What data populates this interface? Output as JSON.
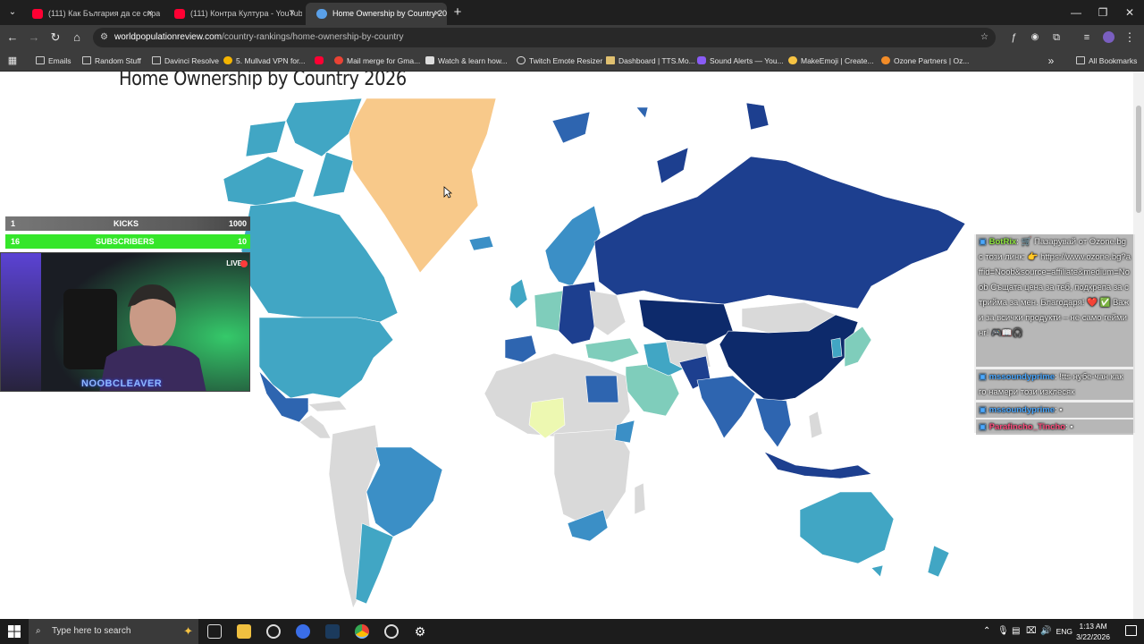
{
  "browser": {
    "tabs": [
      {
        "label": "(111) Как България да се справ",
        "active": false,
        "icon": "youtube-icon"
      },
      {
        "label": "(111) Контра Култура - YouTub",
        "active": false,
        "icon": "youtube-icon"
      },
      {
        "label": "Home Ownership by Country 20",
        "active": true,
        "icon": "globe-icon"
      }
    ],
    "new_tab": "+",
    "close_glyph": "×",
    "url_host": "worldpopulationreview.com",
    "url_path": "/country-rankings/home-ownership-by-country",
    "bookmarks": [
      {
        "label": "Emails",
        "icon": "folder-icon"
      },
      {
        "label": "Random Stuff",
        "icon": "folder-icon"
      },
      {
        "label": "Davinci Resolve",
        "icon": "folder-icon"
      },
      {
        "label": "5. Mullvad VPN for...",
        "icon": "mullvad-icon"
      },
      {
        "label": "",
        "icon": "youtube-icon"
      },
      {
        "label": "Mail merge for Gma...",
        "icon": "mail-merge-icon"
      },
      {
        "label": "Watch & learn how...",
        "icon": "camera-icon"
      },
      {
        "label": "Twitch Emote Resizer",
        "icon": "gear-icon"
      },
      {
        "label": "Dashboard | TTS.Mo...",
        "icon": "bookmark-icon"
      },
      {
        "label": "Sound Alerts — You...",
        "icon": "sound-alerts-icon"
      },
      {
        "label": "MakeEmoji | Create...",
        "icon": "emoji-icon"
      },
      {
        "label": "Ozone Partners | Oz...",
        "icon": "ozone-icon"
      }
    ],
    "all_bookmarks": "All Bookmarks",
    "more_glyph": "»"
  },
  "page": {
    "title": "Home Ownership by Country 2026",
    "map_colors": {
      "darkest": "#0d2a6b",
      "dark": "#1d3f8f",
      "mid_dark": "#2e65b0",
      "mid": "#3b8fc6",
      "light_mid": "#41a6c4",
      "light": "#7fcdbb",
      "lightest": "#edf8b1",
      "greenland": "#f8c98a",
      "no_data": "#d9d9d9"
    }
  },
  "stream": {
    "kicks": {
      "left": "1",
      "label": "KICKS",
      "right": "1000"
    },
    "subscribers": {
      "left": "16",
      "label": "SUBSCRIBERS",
      "right": "10"
    },
    "live_badge": "LIVE",
    "cam_name": "NOOBCLEAVER",
    "chat": [
      {
        "user": "BotRix",
        "text": "🛒 Пазарувай от Ozone.bg с този линк: 👉 https://www.ozone.bg?affid=Noob&source=affiliate&medium=Noob Същата цена за теб, подкрепа за стрийма за мен. Благодаря! ❤️ ✅ Важи за всички продукти – не само гейминг! 🎮📖🎧"
      },
      {
        "user": "mssoundyprime",
        "text": "!tts нубе-чан как го намери този изклесяк"
      },
      {
        "user": "mssoundyprime",
        "text": ""
      },
      {
        "user": "Parafincho_Tincho",
        "text": ""
      }
    ]
  },
  "taskbar": {
    "search_placeholder": "Type here to search",
    "language": "ENG",
    "time": "1:13 AM",
    "date": "3/22/2026"
  }
}
